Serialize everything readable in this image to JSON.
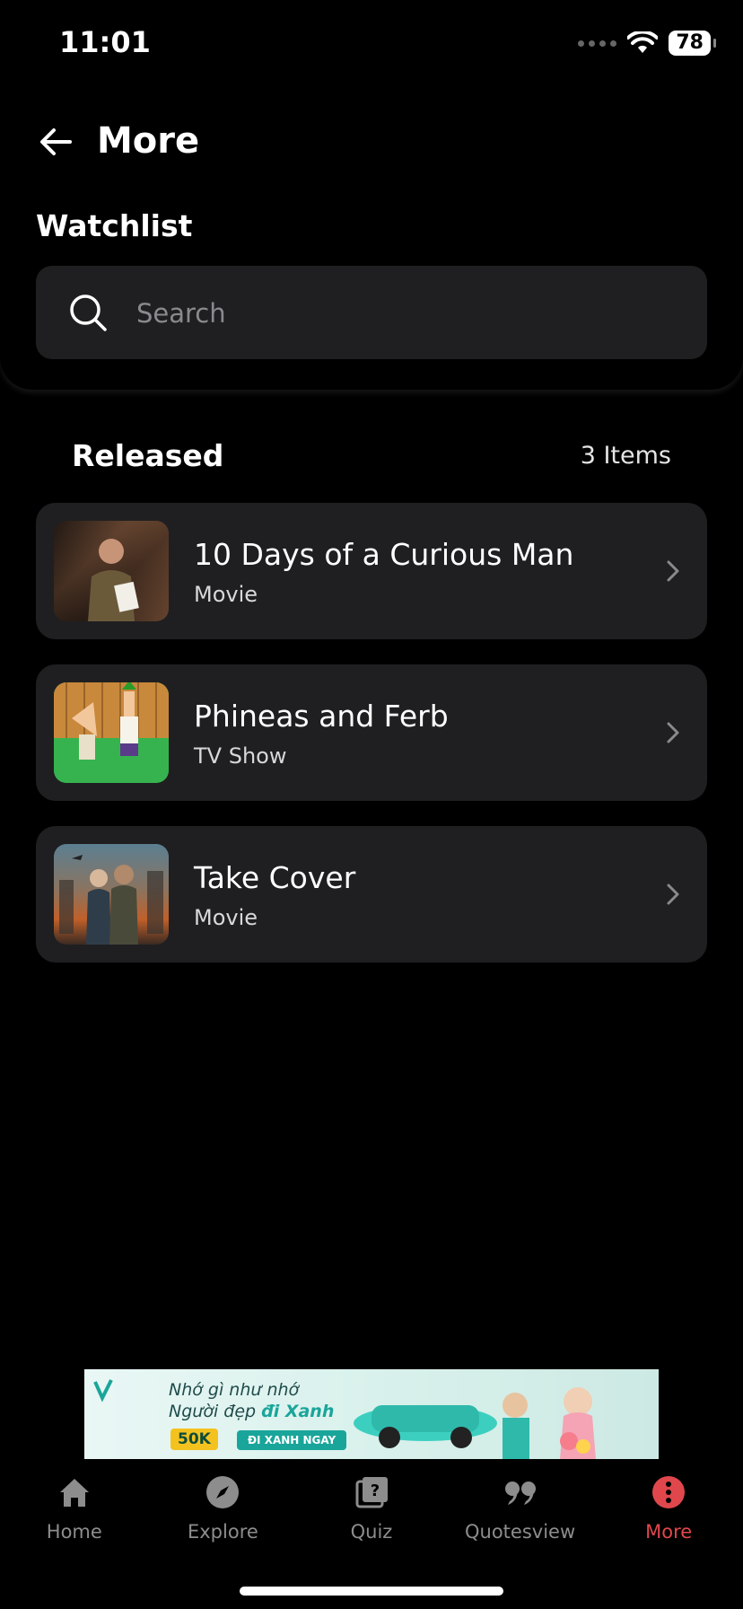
{
  "status_bar": {
    "time": "11:01",
    "battery": "78"
  },
  "header": {
    "title": "More",
    "section": "Watchlist"
  },
  "search": {
    "placeholder": "Search"
  },
  "list": {
    "title": "Released",
    "count": "3 Items",
    "items": [
      {
        "title": "10 Days of a Curious Man",
        "type": "Movie"
      },
      {
        "title": "Phineas and Ferb",
        "type": "TV Show"
      },
      {
        "title": "Take Cover",
        "type": "Movie"
      }
    ]
  },
  "ad": {
    "line1": "Nhớ gì như nhớ",
    "line2_prefix": "Người đẹp ",
    "line2_highlight": "đi Xanh",
    "badge": "50K",
    "cta": "ĐI XANH NGAY"
  },
  "tabs": [
    {
      "label": "Home",
      "icon": "home-icon"
    },
    {
      "label": "Explore",
      "icon": "compass-icon"
    },
    {
      "label": "Quiz",
      "icon": "quiz-icon"
    },
    {
      "label": "Quotesview",
      "icon": "quote-icon"
    },
    {
      "label": "More",
      "icon": "more-icon"
    }
  ],
  "colors": {
    "accent": "#e0474c",
    "card": "#1f1f21",
    "background": "#000000"
  }
}
